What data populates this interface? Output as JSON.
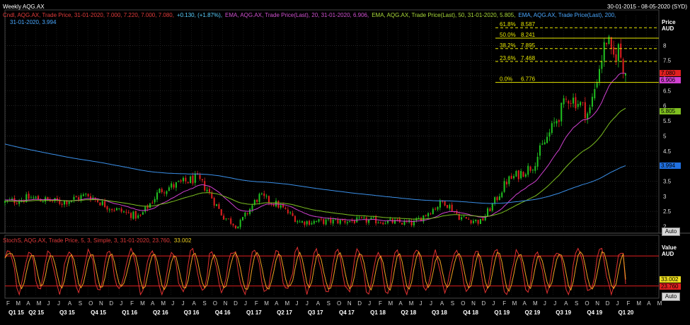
{
  "header": {
    "title": "Weekly AQG.AX",
    "date_range": "30-01-2015 - 08-05-2020 (SYD)"
  },
  "legend_upper": {
    "line1": [
      {
        "text": "Cndl, AQG.AX, Trade Price, 31-01-2020, 7.000, 7.220, 7.000, 7.080,",
        "color": "#e03a3a"
      },
      {
        "text": "+0.130, (+1.87%),",
        "color": "#5ad0ff"
      },
      {
        "text": "EMA, AQG.AX, Trade Price(Last), 20, 31-01-2020, 6.906,",
        "color": "#d050d0"
      },
      {
        "text": "EMA, AQG.AX, Trade Price(Last), 50, 31-01-2020, 5.805,",
        "color": "#a8d838"
      },
      {
        "text": "EMA, AQG.AX, Trade Price(Last), 200,",
        "color": "#4aa8ff"
      }
    ],
    "line2": {
      "text": "31-01-2020, 3.994",
      "color": "#4aa8ff"
    }
  },
  "legend_lower": [
    {
      "text": "StochS, AQG.AX, Trade Price, 5, 3, Simple, 3, 31-01-2020, 23.760,",
      "color": "#e03a3a"
    },
    {
      "text": "33.002",
      "color": "#f0d020"
    }
  ],
  "axis": {
    "upper_unit": [
      "Price",
      "AUD"
    ],
    "lower_unit": [
      "Value",
      "AUD"
    ],
    "auto_label": "Auto"
  },
  "value_tags": [
    {
      "id": "close",
      "value": "7.080",
      "bg": "#e02020",
      "fg": "#000"
    },
    {
      "id": "ema20",
      "value": "6.906",
      "bg": "#d040d0",
      "fg": "#000"
    },
    {
      "id": "ema50",
      "value": "5.805",
      "bg": "#80c020",
      "fg": "#000"
    },
    {
      "id": "ema200",
      "value": "3.994",
      "bg": "#2070e0",
      "fg": "#000"
    },
    {
      "id": "stoch_d",
      "value": "33.002",
      "bg": "#f0e020",
      "fg": "#000"
    },
    {
      "id": "stoch_k",
      "value": "23.760",
      "bg": "#e02020",
      "fg": "#000"
    }
  ],
  "chart_data": [
    {
      "type": "candlestick",
      "title": "Weekly AQG.AX",
      "ylabel": "Price AUD",
      "ylim": [
        1.85,
        8.85
      ],
      "yticks": [
        "2",
        "2.5",
        "3",
        "3.5",
        "4",
        "4.5",
        "5",
        "5.5",
        "6",
        "6.5",
        "7",
        "7.5",
        "8"
      ],
      "grid": true,
      "x_range": [
        "2015-01-30",
        "2020-05-08"
      ],
      "anchors": [
        {
          "date": "2015-01-30",
          "close": 2.8
        },
        {
          "date": "2015-04-15",
          "close": 2.95
        },
        {
          "date": "2015-07-15",
          "close": 2.8
        },
        {
          "date": "2015-10-01",
          "close": 3.05
        },
        {
          "date": "2015-12-01",
          "close": 2.65
        },
        {
          "date": "2016-03-01",
          "close": 2.3
        },
        {
          "date": "2016-05-01",
          "close": 3.2
        },
        {
          "date": "2016-08-15",
          "close": 3.6
        },
        {
          "date": "2016-09-15",
          "close": 3.25
        },
        {
          "date": "2016-11-01",
          "close": 2.35
        },
        {
          "date": "2016-12-15",
          "close": 2.0
        },
        {
          "date": "2017-02-15",
          "close": 3.0
        },
        {
          "date": "2017-04-15",
          "close": 2.7
        },
        {
          "date": "2017-06-15",
          "close": 2.15
        },
        {
          "date": "2018-01-15",
          "close": 2.2
        },
        {
          "date": "2018-05-15",
          "close": 2.1
        },
        {
          "date": "2018-07-15",
          "close": 2.6
        },
        {
          "date": "2018-08-15",
          "close": 2.85
        },
        {
          "date": "2018-10-01",
          "close": 2.3
        },
        {
          "date": "2018-12-01",
          "close": 2.15
        },
        {
          "date": "2019-01-15",
          "close": 2.9
        },
        {
          "date": "2019-02-15",
          "close": 3.5
        },
        {
          "date": "2019-05-01",
          "close": 4.0
        },
        {
          "date": "2019-07-01",
          "close": 5.3
        },
        {
          "date": "2019-08-15",
          "close": 6.3
        },
        {
          "date": "2019-09-15",
          "close": 6.1
        },
        {
          "date": "2019-10-15",
          "close": 5.7
        },
        {
          "date": "2019-11-15",
          "close": 7.3
        },
        {
          "date": "2019-12-08",
          "close": 8.3
        },
        {
          "date": "2019-12-22",
          "close": 7.5
        },
        {
          "date": "2020-01-10",
          "close": 7.9
        },
        {
          "date": "2020-01-31",
          "close": 7.08
        }
      ],
      "last_candle": {
        "date": "2020-01-31",
        "open": 7.0,
        "high": 7.22,
        "low": 7.0,
        "close": 7.08,
        "change": 0.13,
        "change_pct": 1.87
      },
      "ema": [
        {
          "period": 20,
          "last": 6.906,
          "color": "#d040d0"
        },
        {
          "period": 50,
          "last": 5.805,
          "color": "#7cc020"
        },
        {
          "period": 200,
          "last": 3.994,
          "color": "#3a8fe8"
        }
      ],
      "fibonacci": {
        "color": "#e8e800",
        "levels": [
          {
            "label": "61.8%",
            "value": 8.587
          },
          {
            "label": "50.0%",
            "value": 8.241
          },
          {
            "label": "38.2%",
            "value": 7.895
          },
          {
            "label": "23.6%",
            "value": 7.468
          },
          {
            "label": "0.0%",
            "value": 6.776
          }
        ],
        "solid_levels": [
          "50.0%",
          "0.0%"
        ]
      }
    },
    {
      "type": "line",
      "title": "StochS, AQG.AX, Trade Price, 5, 3, Simple, 3",
      "ylim": [
        0,
        100
      ],
      "upper_band": 80,
      "lower_band": 20,
      "series": [
        {
          "name": "%K",
          "color": "#e03030",
          "last": 23.76
        },
        {
          "name": "%D",
          "color": "#f0a020",
          "last": 33.002
        }
      ]
    }
  ],
  "x_axis": {
    "months": [
      "F",
      "M",
      "A",
      "M",
      "J",
      "J",
      "A",
      "S",
      "O",
      "N",
      "D",
      "J",
      "F",
      "M",
      "A",
      "M",
      "J",
      "J",
      "A",
      "S",
      "O",
      "N",
      "D",
      "J",
      "F",
      "M",
      "A",
      "M",
      "J",
      "J",
      "A",
      "S",
      "O",
      "N",
      "D",
      "J",
      "F",
      "M",
      "A",
      "M",
      "J",
      "J",
      "A",
      "S",
      "O",
      "N",
      "D",
      "J",
      "F",
      "M",
      "A",
      "M",
      "J",
      "J",
      "A",
      "S",
      "O",
      "N",
      "D",
      "J",
      "F",
      "M",
      "A",
      "M"
    ],
    "quarters": [
      "Q1 15",
      "Q2 15",
      "Q3 15",
      "Q4 15",
      "Q1 16",
      "Q2 16",
      "Q3 16",
      "Q4 16",
      "Q1 17",
      "Q2 17",
      "Q3 17",
      "Q4 17",
      "Q1 18",
      "Q2 18",
      "Q3 18",
      "Q4 18",
      "Q1 19",
      "Q2 19",
      "Q3 19",
      "Q4 19",
      "Q1 20"
    ]
  }
}
